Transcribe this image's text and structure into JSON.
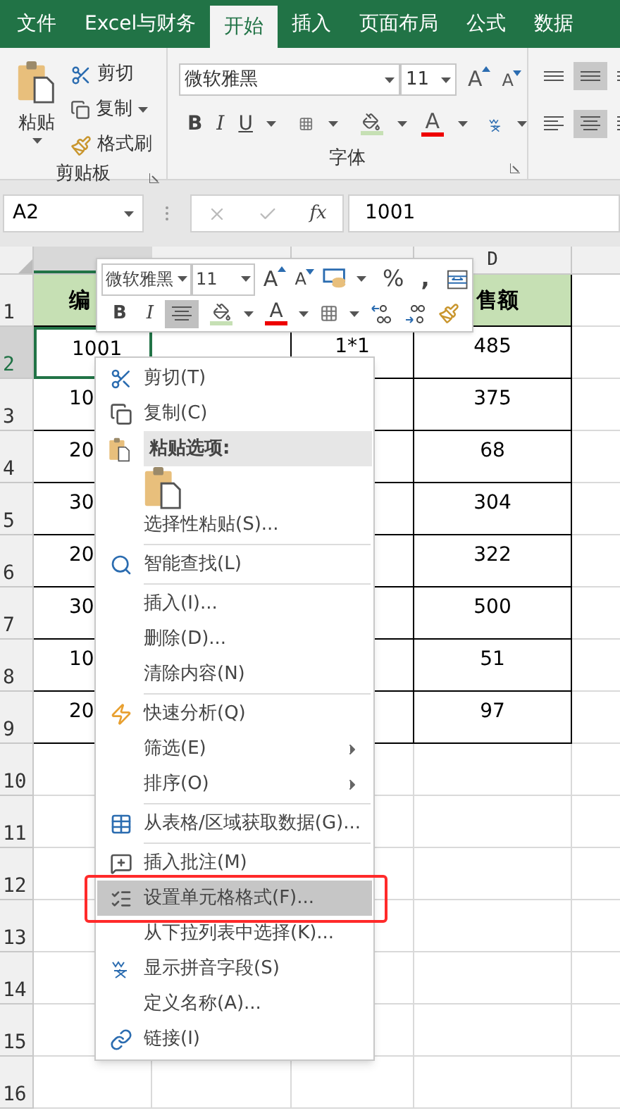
{
  "tabs": [
    {
      "label": "文件",
      "selected": false
    },
    {
      "label": "Excel与财务",
      "selected": false
    },
    {
      "label": "开始",
      "selected": true
    },
    {
      "label": "插入",
      "selected": false
    },
    {
      "label": "页面布局",
      "selected": false
    },
    {
      "label": "公式",
      "selected": false
    },
    {
      "label": "数据",
      "selected": false
    }
  ],
  "ribbon": {
    "clipboard": {
      "paste": "粘贴",
      "cut": "剪切",
      "copy": "复制",
      "format_painter": "格式刷",
      "label": "剪贴板"
    },
    "font": {
      "font_name": "微软雅黑",
      "font_size": "11",
      "grow": "A",
      "shrink": "A",
      "bold": "B",
      "italic": "I",
      "underline": "U",
      "font_color": "A",
      "label": "字体"
    }
  },
  "formula_bar": {
    "name_box": "A2",
    "fx": "fx",
    "value": "1001"
  },
  "column_d_header": "D",
  "rows": [
    {
      "number": "1",
      "kind": "header",
      "selected": false,
      "a": "编",
      "d": "售额"
    },
    {
      "number": "2",
      "kind": "data",
      "selected": true,
      "a": "1001",
      "c": "1*1",
      "d": "485"
    },
    {
      "number": "3",
      "kind": "data",
      "selected": false,
      "a": "10",
      "d": "375"
    },
    {
      "number": "4",
      "kind": "data",
      "selected": false,
      "a": "20",
      "d": "68"
    },
    {
      "number": "5",
      "kind": "data",
      "selected": false,
      "a": "30",
      "d": "304"
    },
    {
      "number": "6",
      "kind": "data",
      "selected": false,
      "a": "20",
      "d": "322"
    },
    {
      "number": "7",
      "kind": "data",
      "selected": false,
      "a": "30",
      "d": "500"
    },
    {
      "number": "8",
      "kind": "data",
      "selected": false,
      "a": "10",
      "d": "51"
    },
    {
      "number": "9",
      "kind": "data",
      "selected": false,
      "a": "20",
      "d": "97"
    },
    {
      "number": "10",
      "kind": "empty",
      "selected": false
    },
    {
      "number": "11",
      "kind": "empty",
      "selected": false
    },
    {
      "number": "12",
      "kind": "empty",
      "selected": false
    },
    {
      "number": "13",
      "kind": "empty",
      "selected": false
    },
    {
      "number": "14",
      "kind": "empty",
      "selected": false
    },
    {
      "number": "15",
      "kind": "empty",
      "selected": false
    },
    {
      "number": "16",
      "kind": "empty",
      "selected": false
    }
  ],
  "mini_toolbar": {
    "font_name": "微软雅黑",
    "font_size": "11",
    "grow": "A",
    "shrink": "A",
    "percent": "%",
    "comma": ",",
    "bold": "B",
    "italic": "I",
    "font_color": "A"
  },
  "context_menu": [
    {
      "kind": "item",
      "label": "剪切(T)",
      "selected": false,
      "submenu": false,
      "outlined": false
    },
    {
      "kind": "item",
      "label": "复制(C)",
      "selected": false,
      "submenu": false,
      "outlined": false
    },
    {
      "kind": "header",
      "label": "粘贴选项:"
    },
    {
      "kind": "paste-button"
    },
    {
      "kind": "item",
      "label": "选择性粘贴(S)...",
      "selected": false,
      "submenu": false,
      "outlined": false
    },
    {
      "kind": "separator"
    },
    {
      "kind": "item",
      "label": "智能查找(L)",
      "selected": false,
      "submenu": false,
      "outlined": false
    },
    {
      "kind": "separator"
    },
    {
      "kind": "item",
      "label": "插入(I)...",
      "selected": false,
      "submenu": false,
      "outlined": false
    },
    {
      "kind": "item",
      "label": "删除(D)...",
      "selected": false,
      "submenu": false,
      "outlined": false
    },
    {
      "kind": "item",
      "label": "清除内容(N)",
      "selected": false,
      "submenu": false,
      "outlined": false
    },
    {
      "kind": "separator"
    },
    {
      "kind": "item",
      "label": "快速分析(Q)",
      "selected": false,
      "submenu": false,
      "outlined": false
    },
    {
      "kind": "item",
      "label": "筛选(E)",
      "selected": false,
      "submenu": true,
      "outlined": false
    },
    {
      "kind": "item",
      "label": "排序(O)",
      "selected": false,
      "submenu": true,
      "outlined": false
    },
    {
      "kind": "separator"
    },
    {
      "kind": "item",
      "label": "从表格/区域获取数据(G)...",
      "selected": false,
      "submenu": false,
      "outlined": false
    },
    {
      "kind": "separator"
    },
    {
      "kind": "item",
      "label": "插入批注(M)",
      "selected": false,
      "submenu": false,
      "outlined": false
    },
    {
      "kind": "item",
      "label": "设置单元格格式(F)...",
      "selected": true,
      "submenu": false,
      "outlined": true
    },
    {
      "kind": "item",
      "label": "从下拉列表中选择(K)...",
      "selected": false,
      "submenu": false,
      "outlined": false
    },
    {
      "kind": "item",
      "label": "显示拼音字段(S)",
      "selected": false,
      "submenu": false,
      "outlined": false
    },
    {
      "kind": "item",
      "label": "定义名称(A)...",
      "selected": false,
      "submenu": false,
      "outlined": false
    },
    {
      "kind": "item",
      "label": "链接(I)",
      "selected": false,
      "submenu": false,
      "outlined": false
    }
  ]
}
